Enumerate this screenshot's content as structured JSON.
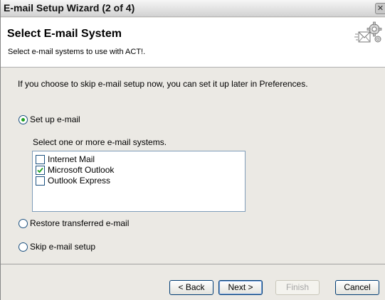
{
  "window": {
    "title": "E-mail Setup Wizard (2 of 4)",
    "close_glyph": "✕"
  },
  "header": {
    "title": "Select E-mail System",
    "subtitle": "Select e-mail systems to use with ACT!.",
    "icon": "mail-wizard-icon"
  },
  "body": {
    "info": "If you choose to skip e-mail setup now, you can set it up later in Preferences.",
    "options": [
      {
        "label": "Set up e-mail",
        "selected": true
      },
      {
        "label": "Restore transferred e-mail",
        "selected": false
      },
      {
        "label": "Skip e-mail setup",
        "selected": false
      }
    ],
    "systems_hint": "Select one or more e-mail systems.",
    "systems": [
      {
        "label": "Internet Mail",
        "checked": false
      },
      {
        "label": "Microsoft Outlook",
        "checked": true
      },
      {
        "label": "Outlook Express",
        "checked": false
      }
    ]
  },
  "footer": {
    "back_label": "< Back",
    "next_label": "Next >",
    "finish_label": "Finish",
    "cancel_label": "Cancel"
  },
  "colors": {
    "radio_dot": "#21a121",
    "check_mark": "#21a121",
    "button_border": "#003c74"
  }
}
